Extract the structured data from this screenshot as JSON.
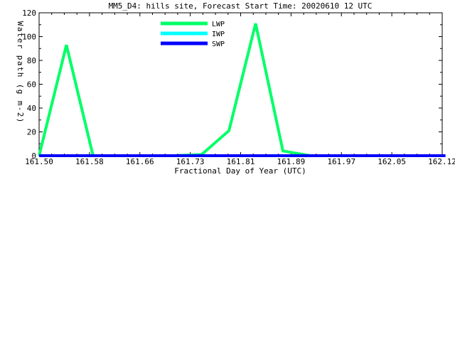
{
  "chart_data": {
    "type": "line",
    "title": "MM5_D4: hills site,  Forecast Start Time: 20020610 12 UTC",
    "xlabel": "Fractional Day of Year (UTC)",
    "ylabel": "Water path (g m-2)",
    "xlim": [
      161.5,
      162.12
    ],
    "ylim": [
      0,
      120
    ],
    "x_ticks": [
      "161.50",
      "161.58",
      "161.66",
      "161.73",
      "161.81",
      "161.89",
      "161.97",
      "162.05",
      "162.12"
    ],
    "y_ticks": [
      "0",
      "20",
      "40",
      "60",
      "80",
      "100",
      "120"
    ],
    "legend_position": "top-center",
    "grid": false,
    "series": [
      {
        "name": "LWP",
        "color": "#00ff66",
        "x": [
          161.5,
          161.542,
          161.583,
          161.625,
          161.667,
          161.708,
          161.75,
          161.792,
          161.833,
          161.875,
          161.917,
          161.958,
          162.0,
          162.042,
          162.083,
          162.125
        ],
        "y": [
          0,
          93,
          0,
          0,
          0,
          0,
          1,
          21,
          111,
          4,
          0,
          0,
          0,
          0,
          0,
          0
        ]
      },
      {
        "name": "IWP",
        "color": "#00ffff",
        "x": [
          161.5,
          162.125
        ],
        "y": [
          0,
          0
        ]
      },
      {
        "name": "SWP",
        "color": "#0000ff",
        "x": [
          161.5,
          162.125
        ],
        "y": [
          0,
          0
        ]
      }
    ]
  }
}
